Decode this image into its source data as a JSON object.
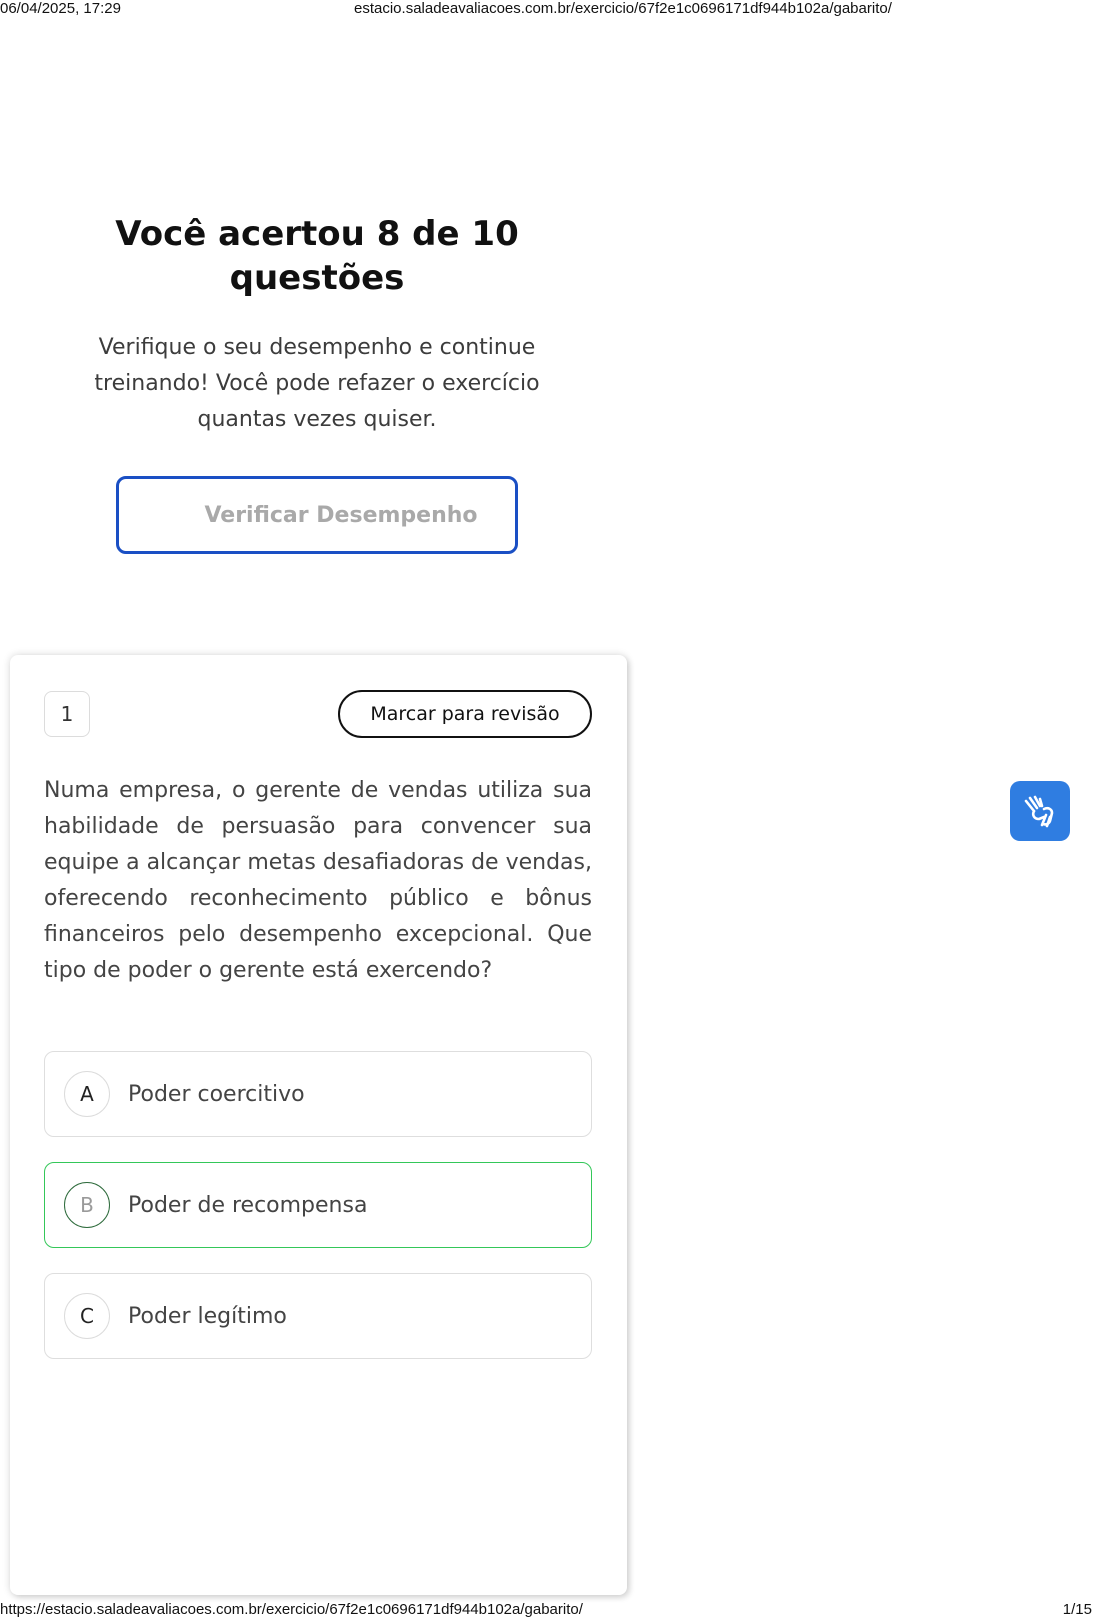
{
  "print_header": {
    "datetime": "06/04/2025, 17:29",
    "url": "estacio.saladeavaliacoes.com.br/exercicio/67f2e1c0696171df944b102a/gabarito/"
  },
  "print_footer": {
    "url": "https://estacio.saladeavaliacoes.com.br/exercicio/67f2e1c0696171df944b102a/gabarito/",
    "page": "1/15"
  },
  "result": {
    "title": "Você acertou 8 de 10 questões",
    "subtitle": "Verifique o seu desempenho e continue treinando! Você pode refazer o exercício quantas vezes quiser.",
    "verify_button_label": "Verificar Desempenho"
  },
  "question": {
    "number": "1",
    "review_button_label": "Marcar para revisão",
    "text": "Numa empresa, o gerente de vendas utiliza sua habilidade de persuasão para convencer sua equipe a alcançar metas desafiadoras de vendas, oferecendo reconhecimento público e bônus financeiros pelo desempenho excepcional. Que tipo de poder o gerente está exercendo?",
    "options": [
      {
        "letter": "A",
        "label": "Poder coercitivo"
      },
      {
        "letter": "B",
        "label": "Poder de recompensa"
      },
      {
        "letter": "C",
        "label": "Poder legítimo"
      }
    ]
  },
  "accessibility": {
    "icon": "sign-language-icon"
  },
  "colors": {
    "primary_blue": "#1a4fc4",
    "correct_green": "#34c759",
    "a11y_blue": "#2f7de1"
  }
}
